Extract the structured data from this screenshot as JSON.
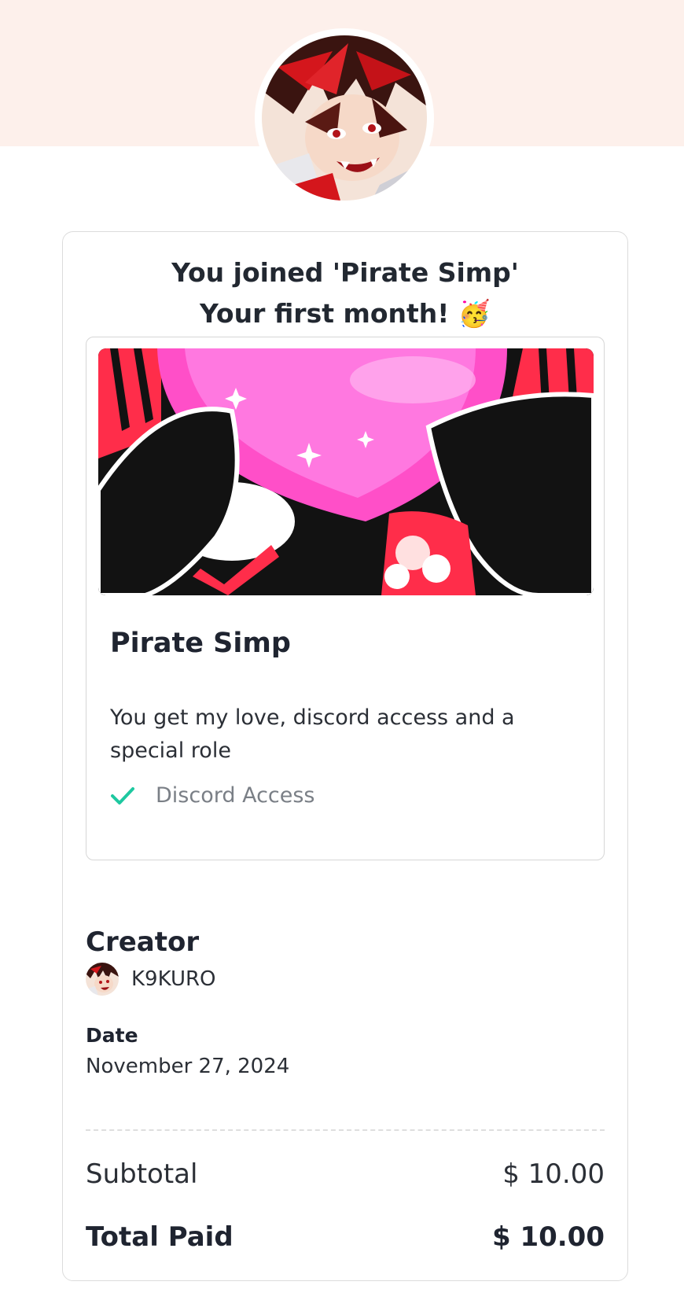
{
  "header": {
    "avatar_icon": "creator-avatar-illustration",
    "band_color": "#fdf0eb"
  },
  "receipt": {
    "headline_line1": "You joined 'Pirate Simp'",
    "headline_line2": "Your first month!",
    "headline_emoji": "🥳"
  },
  "tier": {
    "image_icon": "heart-banner-illustration",
    "name": "Pirate Simp",
    "description": "You get my love, discord access and a special role",
    "benefits": [
      {
        "label": "Discord Access",
        "icon": "checkmark-icon",
        "color": "#1ec8a0"
      }
    ]
  },
  "creator": {
    "title": "Creator",
    "name": "K9KURO"
  },
  "date": {
    "label": "Date",
    "value": "November 27, 2024"
  },
  "totals": {
    "subtotal_label": "Subtotal",
    "subtotal_value": "$ 10.00",
    "total_label": "Total Paid",
    "total_value": "$ 10.00"
  }
}
